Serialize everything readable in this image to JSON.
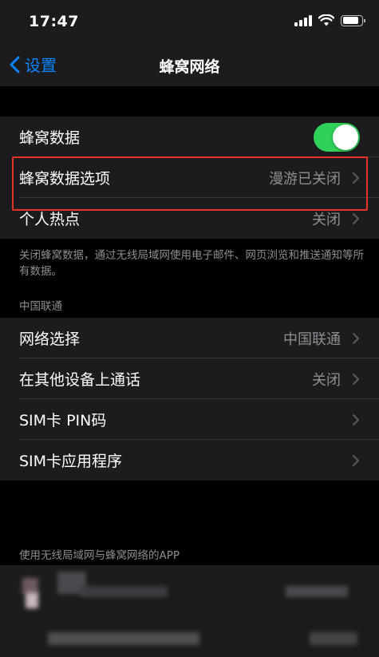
{
  "status_bar": {
    "time": "17:47",
    "battery_level": 0.85
  },
  "nav": {
    "back_label": "设置",
    "title": "蜂窝网络"
  },
  "group1": {
    "cellular_data": {
      "label": "蜂窝数据",
      "enabled": true
    },
    "cellular_data_options": {
      "label": "蜂窝数据选项",
      "value": "漫游已关闭"
    },
    "personal_hotspot": {
      "label": "个人热点",
      "value": "关闭"
    }
  },
  "group1_footer": "关闭蜂窝数据，通过无线局域网使用电子邮件、网页浏览和推送通知等所有数据。",
  "carrier_section": {
    "header": "中国联通",
    "network_selection": {
      "label": "网络选择",
      "value": "中国联通"
    },
    "calls_on_other_devices": {
      "label": "在其他设备上通话",
      "value": "关闭"
    },
    "sim_pin": {
      "label": "SIM卡 PIN码"
    },
    "sim_apps": {
      "label": "SIM卡应用程序"
    }
  },
  "apps_section": {
    "header": "使用无线局域网与蜂窝网络的APP"
  },
  "colors": {
    "accent": "#0a84ff",
    "toggle_on": "#30d158",
    "highlight": "#e5332a"
  },
  "icons": {
    "back": "chevron-left-icon",
    "disclosure": "chevron-right-icon"
  }
}
